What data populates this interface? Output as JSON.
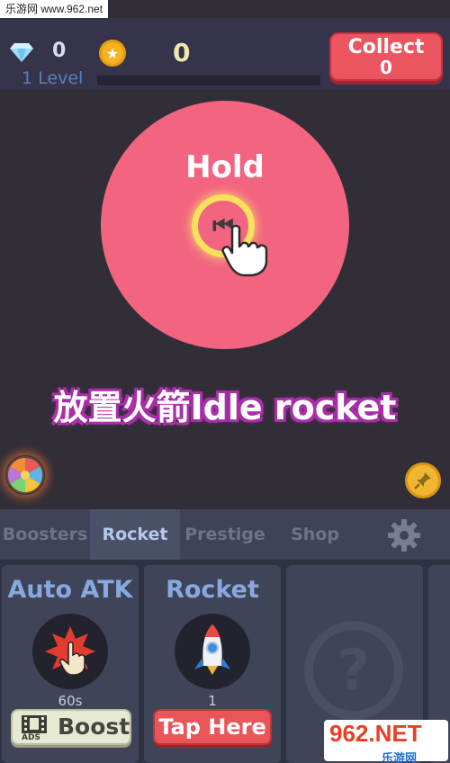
{
  "watermark_top": "乐游网 www.962.net",
  "header": {
    "gems": "0",
    "coins": "0",
    "level_label": "1 Level",
    "level_progress": 0,
    "collect_label": "Collect",
    "collect_value": "0"
  },
  "game": {
    "hold_label": "Hold",
    "title": "放置火箭Idle rocket"
  },
  "tabs": [
    {
      "label": "Boosters",
      "active": false
    },
    {
      "label": "Rocket",
      "active": true
    },
    {
      "label": "Prestige",
      "active": false
    },
    {
      "label": "Shop",
      "active": false
    }
  ],
  "cards": {
    "auto_atk": {
      "title": "Auto ATK",
      "value": "60s",
      "button": "Boost",
      "badge": "ADS"
    },
    "rocket": {
      "title": "Rocket",
      "value": "1",
      "button": "Tap Here"
    },
    "locked": {
      "symbol": "?"
    }
  },
  "watermark_bottom": {
    "text": "962.NET",
    "sub": "乐游网"
  },
  "colors": {
    "background": "#312e37",
    "circle": "#f2647f",
    "accent_blue": "#87a9e0",
    "collect_red": "#ea5560",
    "ring_yellow": "#f5e15b",
    "title_outline": "#a92fa8"
  },
  "icons": [
    "diamond-icon",
    "coin-icon",
    "hand-pointer-icon",
    "fortune-wheel-icon",
    "pin-icon",
    "gear-icon",
    "tap-target-icon",
    "rocket-icon",
    "film-icon",
    "question-icon"
  ]
}
